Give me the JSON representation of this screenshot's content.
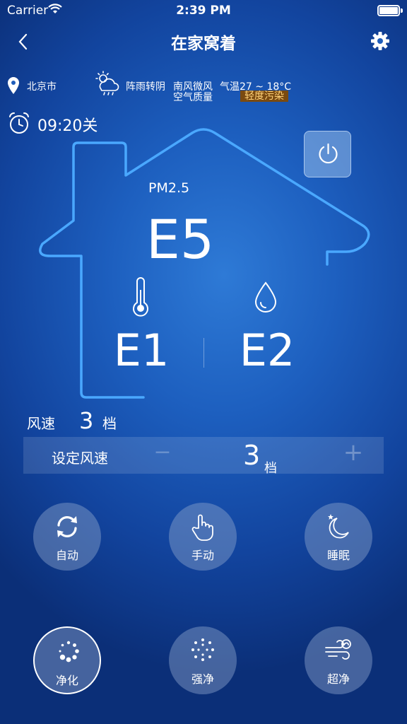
{
  "status_bar": {
    "carrier": "Carrier",
    "time": "2:39 PM"
  },
  "nav": {
    "title": "在家窝着"
  },
  "weather": {
    "city": "北京市",
    "condition": "阵雨转阴",
    "wind": "南风微风",
    "temperature": "气温27 ~ 18°C",
    "air_quality_label": "空气质量",
    "air_quality_value": "轻度污染"
  },
  "timer": {
    "text": "09:20关"
  },
  "readings": {
    "pm_label": "PM2.5",
    "pm_value": "E5",
    "temperature_value": "E1",
    "humidity_value": "E2"
  },
  "wind_speed": {
    "label": "风速",
    "value": "3",
    "unit": "档",
    "set_label": "设定风速",
    "set_minus": "−",
    "set_value": "3",
    "set_unit": "档",
    "set_plus": "+"
  },
  "modes": [
    {
      "label": "自动",
      "icon": "refresh-icon"
    },
    {
      "label": "手动",
      "icon": "hand-pointer-icon"
    },
    {
      "label": "睡眠",
      "icon": "moon-icon"
    },
    {
      "label": "净化",
      "icon": "spinner-icon",
      "selected": true
    },
    {
      "label": "强净",
      "icon": "strong-purify-icon"
    },
    {
      "label": "超净",
      "icon": "wind-icon"
    }
  ],
  "colors": {
    "background": "#1d5fbf",
    "house_outline": "#4aa8ff",
    "air_quality_badge": "#7a4a10"
  }
}
